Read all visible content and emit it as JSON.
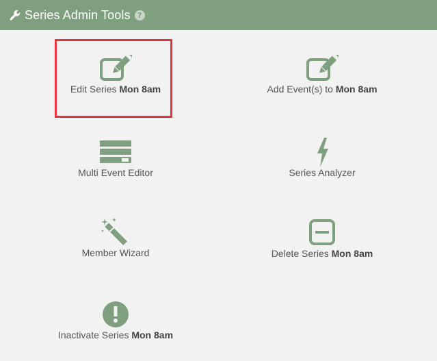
{
  "header": {
    "title": "Series Admin Tools",
    "help_icon": "question-circle-icon",
    "wrench_icon": "wrench-icon",
    "help_glyph": "?"
  },
  "colors": {
    "header_bg": "#7fa07f",
    "icon_green": "#7fa07f",
    "background": "#f2f2f2",
    "highlight_border": "#e8323a"
  },
  "tools": [
    {
      "id": "edit-series",
      "icon": "edit-icon",
      "label_prefix": "Edit Series ",
      "label_bold": "Mon 8am",
      "highlighted": true
    },
    {
      "id": "add-events",
      "icon": "edit-icon",
      "label_prefix": "Add Event(s) to ",
      "label_bold": "Mon 8am",
      "highlighted": false
    },
    {
      "id": "multi-event-editor",
      "icon": "server-stack-icon",
      "label_prefix": "Multi Event Editor",
      "label_bold": "",
      "highlighted": false
    },
    {
      "id": "series-analyzer",
      "icon": "lightning-bolt-icon",
      "label_prefix": "Series Analyzer",
      "label_bold": "",
      "highlighted": false
    },
    {
      "id": "member-wizard",
      "icon": "magic-wand-icon",
      "label_prefix": "Member Wizard",
      "label_bold": "",
      "highlighted": false
    },
    {
      "id": "delete-series",
      "icon": "minus-square-icon",
      "label_prefix": "Delete Series ",
      "label_bold": "Mon 8am",
      "highlighted": false
    },
    {
      "id": "inactivate-series",
      "icon": "exclamation-circle-icon",
      "label_prefix": "Inactivate Series ",
      "label_bold": "Mon 8am",
      "highlighted": false
    }
  ]
}
